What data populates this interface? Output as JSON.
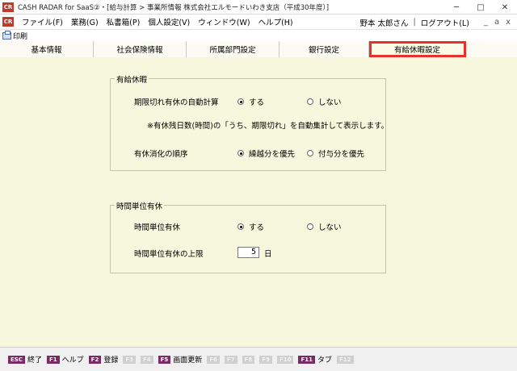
{
  "window": {
    "icon_text": "CR",
    "title": "CASH RADAR for SaaS②・[給与計算 > 事業所情報 株式会社エルモードいわき支店（平成30年度）]",
    "minimize": "─",
    "restore": "□",
    "close": "✕"
  },
  "menu": {
    "items": [
      "ファイル(F)",
      "業務(G)",
      "私書箱(P)",
      "個人設定(V)",
      "ウィンドウ(W)",
      "ヘルプ(H)"
    ],
    "user": "野本 太郎さん",
    "separator": "|",
    "logout": "ログアウト(L)",
    "small_buttons": [
      "_",
      "a",
      "x"
    ]
  },
  "toolbar": {
    "print_label": "印刷"
  },
  "tabs": [
    {
      "label": "基本情報",
      "active": false
    },
    {
      "label": "社会保険情報",
      "active": false
    },
    {
      "label": "所属部門設定",
      "active": false
    },
    {
      "label": "銀行設定",
      "active": false
    },
    {
      "label": "有給休暇設定",
      "active": true
    }
  ],
  "paid_leave": {
    "title": "有給休暇",
    "auto_calc_label": "期限切れ有休の自動計算",
    "auto_calc_options": [
      "する",
      "しない"
    ],
    "auto_calc_selected": "する",
    "note": "※有休残日数(時間)の「うち、期限切れ」を自動集計して表示します。",
    "order_label": "有休消化の順序",
    "order_options": [
      "繰越分を優先",
      "付与分を優先"
    ],
    "order_selected": "繰越分を優先"
  },
  "hourly_leave": {
    "title": "時間単位有休",
    "hourly_label": "時間単位有休",
    "hourly_options": [
      "する",
      "しない"
    ],
    "hourly_selected": "する",
    "limit_label": "時間単位有休の上限",
    "limit_value": "5",
    "limit_unit": "日"
  },
  "function_keys": [
    {
      "key": "ESC",
      "label": "終了",
      "enabled": true
    },
    {
      "key": "F1",
      "label": "ヘルプ",
      "enabled": true
    },
    {
      "key": "F2",
      "label": "登録",
      "enabled": true
    },
    {
      "key": "F3",
      "label": "",
      "enabled": false
    },
    {
      "key": "F4",
      "label": "",
      "enabled": false
    },
    {
      "key": "F5",
      "label": "画面更新",
      "enabled": true
    },
    {
      "key": "F6",
      "label": "",
      "enabled": false
    },
    {
      "key": "F7",
      "label": "",
      "enabled": false
    },
    {
      "key": "F8",
      "label": "",
      "enabled": false
    },
    {
      "key": "F9",
      "label": "",
      "enabled": false
    },
    {
      "key": "F10",
      "label": "",
      "enabled": false
    },
    {
      "key": "F11",
      "label": "タブ",
      "enabled": true
    },
    {
      "key": "F12",
      "label": "",
      "enabled": false
    }
  ],
  "colors": {
    "content_bg": "#f7f7dd",
    "active_tab_highlight": "#e8312a",
    "fkey_color": "#7a2b63"
  }
}
